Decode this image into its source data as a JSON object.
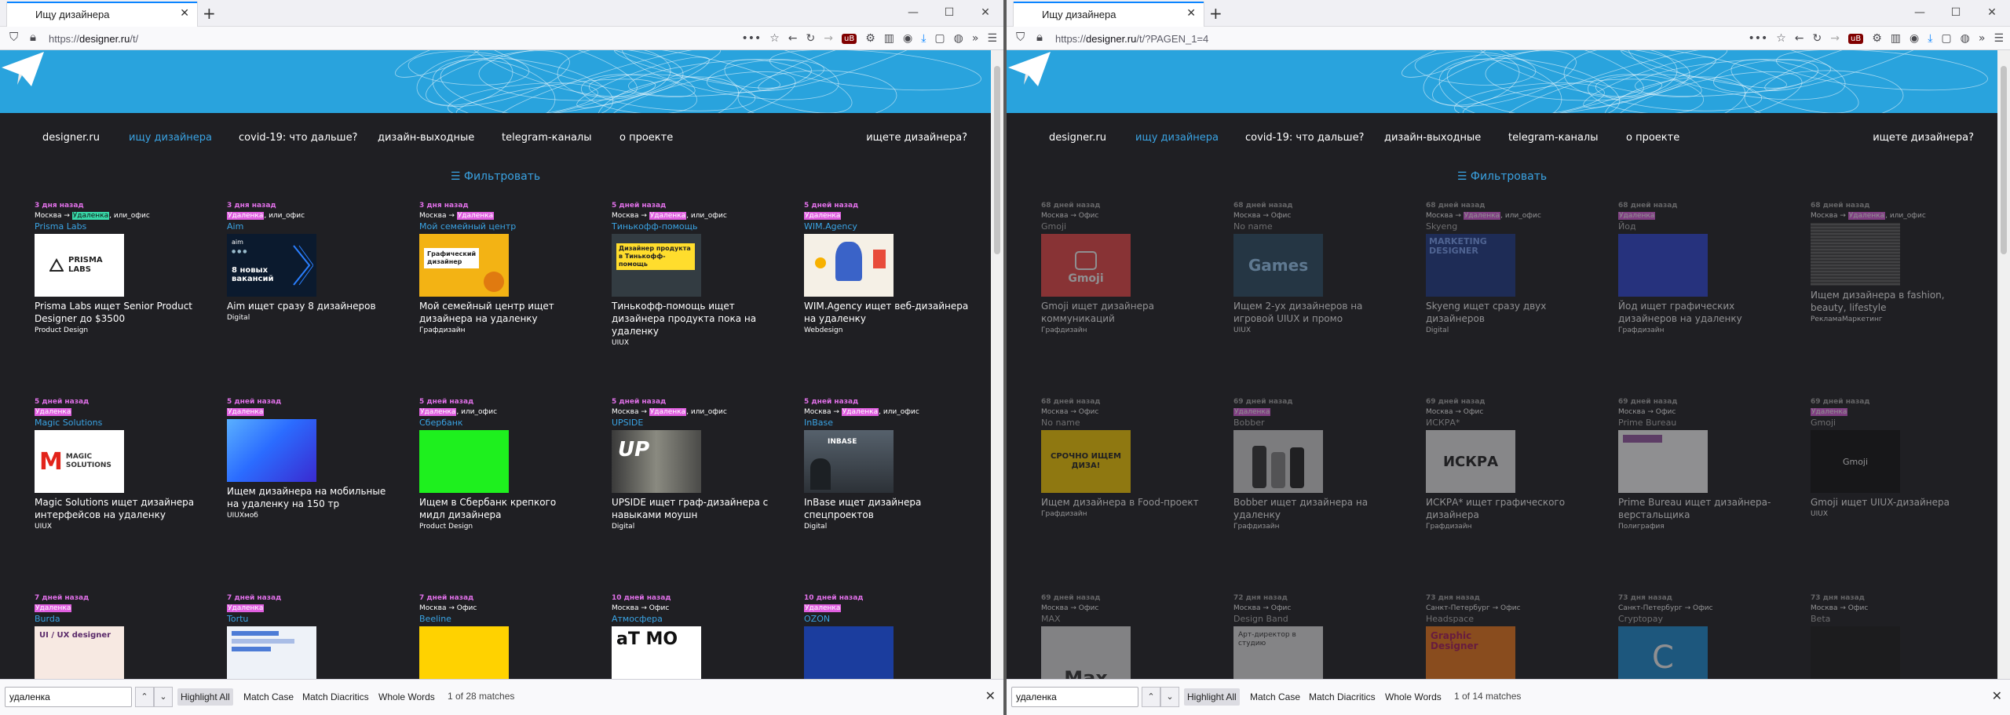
{
  "windows": [
    {
      "tab_title": "Ищу дизайнера",
      "url_host": "designer.ru",
      "url_prefix": "https://",
      "url_path": "/t/",
      "find": {
        "query": "удаленка",
        "highlight_all": "Highlight All",
        "match_case": "Match Case",
        "match_diacritics": "Match Diacritics",
        "whole_words": "Whole Words",
        "status": "1 of 28 matches"
      },
      "cards": [
        {
          "date": "3 дня назад",
          "loc": [
            "Москва → ",
            "Удаленка",
            ", или_офис"
          ],
          "company": "Prisma Labs",
          "title": "Prisma Labs ищет Senior Product Designer до $3500",
          "cat": "Product Design",
          "img": "prisma"
        },
        {
          "date": "3 дня назад",
          "loc": [
            "",
            "Удаленка",
            ", или_офис"
          ],
          "company": "Aim",
          "title": "Aim ищет сразу 8 дизайнеров",
          "cat": "Digital",
          "img": "aim"
        },
        {
          "date": "3 дня назад",
          "loc": [
            "Москва → ",
            "Удаленка",
            ""
          ],
          "company": "Мой семейный центр",
          "title": "Мой семейный центр ищет дизайнера на удаленку",
          "cat": "Графдизайн",
          "img": "family"
        },
        {
          "date": "5 дней назад",
          "loc": [
            "Москва → ",
            "Удаленка",
            ", или_офис"
          ],
          "company": "Тинькофф-помощь",
          "title": "Тинькофф-помощь ищет дизайнера продукта пока на удаленку",
          "cat": "UIUX",
          "img": "tinkoff"
        },
        {
          "date": "5 дней назад",
          "loc": [
            "",
            "Удаленка",
            ""
          ],
          "company": "WIM.Agency",
          "title": "WIM.Agency ищет веб-дизайнера на удаленку",
          "cat": "Webdesign",
          "img": "wim"
        },
        {
          "date": "5 дней назад",
          "loc": [
            "",
            "Удаленка",
            ""
          ],
          "company": "Magic Solutions",
          "title": "Magic Solutions ищет дизайнера интерфейсов на удаленку",
          "cat": "UIUX",
          "img": "magic"
        },
        {
          "date": "5 дней назад",
          "loc": [
            "",
            "Удаленка",
            ""
          ],
          "company": "",
          "title": "Ищем дизайнера на мобильные на удаленку на 150 тр",
          "cat": "UIUXмоб",
          "img": "mosaic"
        },
        {
          "date": "5 дней назад",
          "loc": [
            "",
            "Удаленка",
            ", или_офис"
          ],
          "company": "Сбербанк",
          "title": "Ищем в Сбербанк крепкого мидл дизайнера",
          "cat": "Product Design",
          "img": "sber"
        },
        {
          "date": "5 дней назад",
          "loc": [
            "Москва → ",
            "Удаленка",
            ", или_офис"
          ],
          "company": "UPSIDE",
          "title": "UPSIDE ищет граф-дизайнера с навыками моушн",
          "cat": "Digital",
          "img": "upside"
        },
        {
          "date": "5 дней назад",
          "loc": [
            "Москва → ",
            "Удаленка",
            ", или_офис"
          ],
          "company": "InBase",
          "title": "InBase ищет дизайнера спецпроектов",
          "cat": "Digital",
          "img": "inbase"
        },
        {
          "date": "7 дней назад",
          "loc": [
            "",
            "Удаленка",
            ""
          ],
          "company": "Burda",
          "title": "",
          "cat": "",
          "img": "burda"
        },
        {
          "date": "7 дней назад",
          "loc": [
            "",
            "Удаленка",
            ""
          ],
          "company": "Tortu",
          "title": "",
          "cat": "",
          "img": "tortu"
        },
        {
          "date": "7 дней назад",
          "loc": [
            "Москва → Офис",
            "",
            ""
          ],
          "company": "Beeline",
          "title": "",
          "cat": "",
          "img": "beeline"
        },
        {
          "date": "10 дней назад",
          "loc": [
            "Москва → Офис",
            "",
            ""
          ],
          "company": "Атмосфера",
          "title": "",
          "cat": "",
          "img": "atmo"
        },
        {
          "date": "10 дней назад",
          "loc": [
            "",
            "Удаленка",
            ""
          ],
          "company": "OZON",
          "title": "",
          "cat": "",
          "img": "ozon"
        }
      ]
    },
    {
      "tab_title": "Ищу дизайнера",
      "url_host": "designer.ru",
      "url_prefix": "https://",
      "url_path": "/t/?PAGEN_1=4",
      "find": {
        "query": "удаленка",
        "highlight_all": "Highlight All",
        "match_case": "Match Case",
        "match_diacritics": "Match Diacritics",
        "whole_words": "Whole Words",
        "status": "1 of 14 matches"
      },
      "cards": [
        {
          "date": "68 дней назад",
          "loc": [
            "Москва → Офис",
            "",
            ""
          ],
          "company": "Gmoji",
          "title": "Gmoji ищет дизайнера коммуникаций",
          "cat": "Графдизайн",
          "img": "gmoji"
        },
        {
          "date": "68 дней назад",
          "loc": [
            "Москва → Офис",
            "",
            ""
          ],
          "company": "No name",
          "title": "Ищем 2-ух дизайнеров на игровой UIUX и промо",
          "cat": "UIUX",
          "img": "games"
        },
        {
          "date": "68 дней назад",
          "loc": [
            "Москва → ",
            "Удаленка",
            ", или_офис"
          ],
          "company": "Skyeng",
          "title": "Skyeng ищет сразу двух дизайнеров",
          "cat": "Digital",
          "img": "skyeng"
        },
        {
          "date": "68 дней назад",
          "loc": [
            "",
            "Удаленка",
            ""
          ],
          "company": "Йод",
          "title": "Йод ищет графических дизайнеров на удаленку",
          "cat": "Графдизайн",
          "img": "yod"
        },
        {
          "date": "68 дней назад",
          "loc": [
            "Москва → ",
            "Удаленка",
            ", или_офис"
          ],
          "company": "",
          "title": "Ищем дизайнера в fashion, beauty, lifestyle",
          "cat": "РекламаМаркетинг",
          "img": "fashion"
        },
        {
          "date": "68 дней назад",
          "loc": [
            "Москва → Офис",
            "",
            ""
          ],
          "company": "No name",
          "title": "Ищем дизайнера в Food-проект",
          "cat": "Графдизайн",
          "img": "food"
        },
        {
          "date": "69 дней назад",
          "loc": [
            "",
            "Удаленка",
            ""
          ],
          "company": "Bobber",
          "title": "Bobber ищет дизайнера на удаленку",
          "cat": "Графдизайн",
          "img": "bobber"
        },
        {
          "date": "69 дней назад",
          "loc": [
            "Москва → Офис",
            "",
            ""
          ],
          "company": "ИСКРА*",
          "title": "ИСКРА* ищет графического дизайнера",
          "cat": "Графдизайн",
          "img": "iskra"
        },
        {
          "date": "69 дней назад",
          "loc": [
            "Москва → Офис",
            "",
            ""
          ],
          "company": "Prime Bureau",
          "title": "Prime Bureau ищет дизайнера-верстальщика",
          "cat": "Полиграфия",
          "img": "prime"
        },
        {
          "date": "69 дней назад",
          "loc": [
            "",
            "Удаленка",
            ""
          ],
          "company": "Gmoji",
          "title": "Gmoji ищет UIUX-дизайнера",
          "cat": "UIUX",
          "img": "gmoji2"
        },
        {
          "date": "69 дней назад",
          "loc": [
            "Москва → Офис",
            "",
            ""
          ],
          "company": "MAX",
          "title": "",
          "cat": "",
          "img": "max"
        },
        {
          "date": "72 дня назад",
          "loc": [
            "Москва → Офис",
            "",
            ""
          ],
          "company": "Design Band",
          "title": "",
          "cat": "",
          "img": "band"
        },
        {
          "date": "73 дня назад",
          "loc": [
            "Санкт-Петербург → Офис",
            "",
            ""
          ],
          "company": "Headspace",
          "title": "",
          "cat": "",
          "img": "headspace"
        },
        {
          "date": "73 дня назад",
          "loc": [
            "Санкт-Петербург → Офис",
            "",
            ""
          ],
          "company": "Cryptopay",
          "title": "",
          "cat": "",
          "img": "crypto"
        },
        {
          "date": "73 дня назад",
          "loc": [
            "Москва → Офис",
            "",
            ""
          ],
          "company": "Beta",
          "title": "",
          "cat": "",
          "img": "beta"
        }
      ]
    }
  ],
  "nav": {
    "home": "designer.ru",
    "search": "ищу дизайнера",
    "covid": "covid-19: что дальше?",
    "weekend": "дизайн-выходные",
    "telegram": "telegram-каналы",
    "about": "о проекте",
    "looking": "ищете дизайнера?"
  },
  "filter_label": "Фильтровать",
  "card_images": {
    "prisma_text": "PRISMA LABS",
    "aim_big": "8 новых вакансий",
    "aim_small": "aim",
    "family_text": "Графический дизайнер",
    "tinkoff_text": "Дизайнер продукта в Тинькофф-помощь",
    "magic_text": "MAGIC SOLUTIONS",
    "upside_text": "UP",
    "inbase_text": "INBASE",
    "burda_text": "UI / UX designer",
    "atmo_text": "aT MO",
    "gmoji_text": "Gmoji",
    "games_text": "Games",
    "skyeng_text": "MARKETING DESIGNER",
    "food_text": "СРОЧНО ИЩЕМ ДИЗА!",
    "iskra_text": "ИСКРА",
    "max_text": "Max",
    "band_text": "Арт-директор в студию",
    "headspace_text": "Graphic Designer",
    "crypto_text": "C"
  },
  "colors": {
    "accent": "#3aa3e3",
    "highlight": "#e060e0",
    "hero": "#29a3dd",
    "page_bg": "#1f1f23"
  }
}
